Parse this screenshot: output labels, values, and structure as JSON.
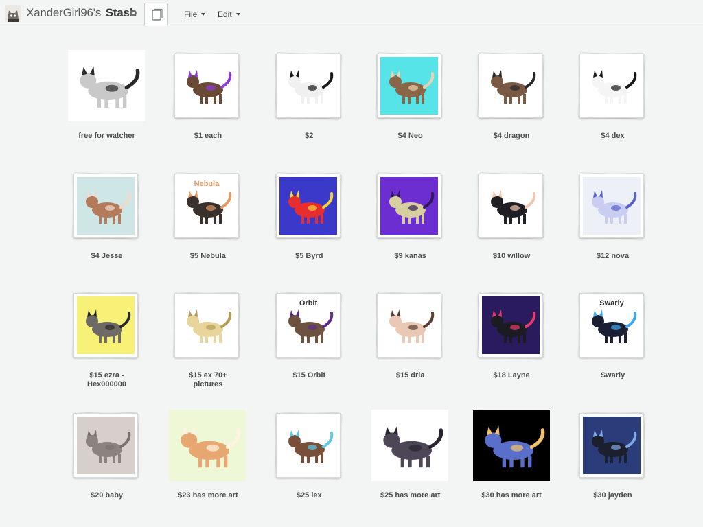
{
  "header": {
    "username": "XanderGirl96's",
    "section": "Stash",
    "menu": [
      {
        "label": "File"
      },
      {
        "label": "Edit"
      }
    ]
  },
  "items": [
    {
      "label": "free for watcher",
      "label2": "",
      "bg": "#ffffff",
      "colors": [
        "#c9c9c9",
        "#2a2a2a"
      ],
      "stack": false
    },
    {
      "label": "$1 each",
      "label2": "",
      "bg": "#ffffff",
      "colors": [
        "#6b4a35",
        "#8c3bd6"
      ],
      "stack": true
    },
    {
      "label": "$2",
      "label2": "",
      "bg": "#ffffff",
      "colors": [
        "#f0f0f0",
        "#1a1a1a"
      ],
      "stack": true
    },
    {
      "label": "$4 Neo",
      "label2": "",
      "bg": "#56e4e8",
      "colors": [
        "#8a6648",
        "#e9d2b1"
      ],
      "stack": true
    },
    {
      "label": "$4 dragon",
      "label2": "",
      "bg": "#ffffff",
      "colors": [
        "#7a5a45",
        "#2a2a2a"
      ],
      "stack": true
    },
    {
      "label": "$4 dex",
      "label2": "",
      "bg": "#ffffff",
      "colors": [
        "#f5f5f5",
        "#1a1a1a"
      ],
      "stack": true
    },
    {
      "label": "$4 Jesse",
      "label2": "",
      "bg": "#cfe6e7",
      "colors": [
        "#b37a5b",
        "#efd9c8"
      ],
      "stack": true
    },
    {
      "label": "$5 Nebula",
      "label2": "Nebula",
      "bg": "#ffffff",
      "colors": [
        "#3a302c",
        "#e39a66"
      ],
      "stack": true
    },
    {
      "label": "$5 Byrd",
      "label2": "",
      "bg": "#3b39c9",
      "colors": [
        "#e72d2d",
        "#f3d23a"
      ],
      "stack": true
    },
    {
      "label": "$9 kanas",
      "label2": "",
      "bg": "#6c2ed0",
      "colors": [
        "#d8cfa0",
        "#2e1a5a"
      ],
      "stack": true
    },
    {
      "label": "$10 willow",
      "label2": "",
      "bg": "#ffffff",
      "colors": [
        "#1e1e24",
        "#f0c7b0"
      ],
      "stack": true
    },
    {
      "label": "$12 nova",
      "label2": "",
      "bg": "#eef0f7",
      "colors": [
        "#c9cdf2",
        "#5a63c8"
      ],
      "stack": true
    },
    {
      "label": "$15 ezra -",
      "label2": "Hex000000",
      "bg": "#f7f277",
      "colors": [
        "#6d6a66",
        "#2a2a2a"
      ],
      "stack": true
    },
    {
      "label": "$15 ex 70+",
      "label2": "pictures",
      "bg": "#ffffff",
      "colors": [
        "#e8d59b",
        "#b39c58"
      ],
      "stack": true
    },
    {
      "label": "$15 Orbit",
      "label2": "Orbit",
      "bg": "#ffffff",
      "colors": [
        "#6e5240",
        "#5c2c88"
      ],
      "stack": true
    },
    {
      "label": "$15 dria",
      "label2": "",
      "bg": "#ffffff",
      "colors": [
        "#e9c9b6",
        "#5a3d30"
      ],
      "stack": true
    },
    {
      "label": "$18 Layne",
      "label2": "",
      "bg": "#2a1b5e",
      "colors": [
        "#1b1b22",
        "#e23c6a"
      ],
      "stack": true
    },
    {
      "label": "Swarly",
      "label2": "Swarly",
      "bg": "#ffffff",
      "colors": [
        "#1b1f33",
        "#3fa6f0"
      ],
      "stack": true
    },
    {
      "label": "$20 baby",
      "label2": "",
      "bg": "#d6cfcc",
      "colors": [
        "#8c8380",
        "#7a706d"
      ],
      "stack": true
    },
    {
      "label": "$23 has more art",
      "label2": "",
      "bg": "#eef7d6",
      "colors": [
        "#e6a870",
        "#fff3e2"
      ],
      "stack": false
    },
    {
      "label": "$25 lex",
      "label2": "",
      "bg": "#ffffff",
      "colors": [
        "#7a4f3a",
        "#5fc9e6"
      ],
      "stack": true
    },
    {
      "label": "$25 has more art",
      "label2": "",
      "bg": "#ffffff",
      "colors": [
        "#4c4656",
        "#2a2430"
      ],
      "stack": false
    },
    {
      "label": "$30 has more art",
      "label2": "",
      "bg": "#000000",
      "colors": [
        "#5a6fc9",
        "#f3c36b"
      ],
      "stack": false
    },
    {
      "label": "$30 jayden",
      "label2": "",
      "bg": "#2a3d7a",
      "colors": [
        "#1b1f2e",
        "#7fa9e6"
      ],
      "stack": true
    }
  ]
}
